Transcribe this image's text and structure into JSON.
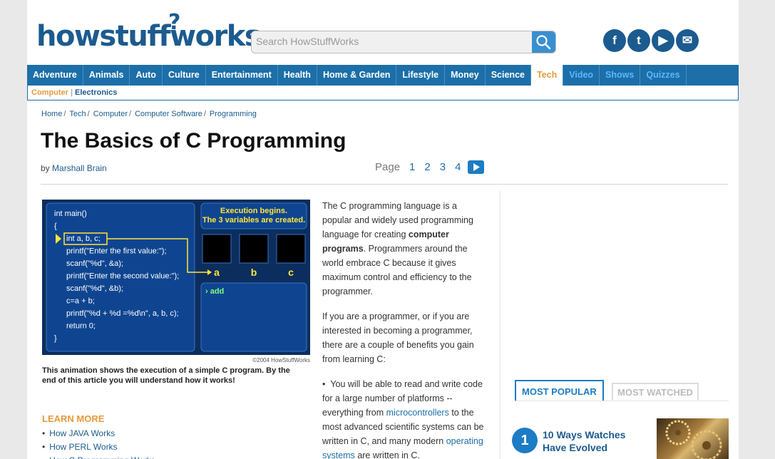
{
  "brand": {
    "logo_text": "howstuffworks",
    "logo_mark": "?"
  },
  "search": {
    "placeholder": "Search HowStuffWorks"
  },
  "social": [
    {
      "name": "facebook-icon",
      "glyph": "f"
    },
    {
      "name": "twitter-icon",
      "glyph": "t"
    },
    {
      "name": "youtube-icon",
      "glyph": "▶"
    },
    {
      "name": "email-icon",
      "glyph": "✉"
    }
  ],
  "nav": {
    "items": [
      "Adventure",
      "Animals",
      "Auto",
      "Culture",
      "Entertainment",
      "Health",
      "Home & Garden",
      "Lifestyle",
      "Money",
      "Science",
      "Tech",
      "Video",
      "Shows",
      "Quizzes"
    ],
    "active": "Tech"
  },
  "subnav": {
    "active": "Computer",
    "other": "Electronics"
  },
  "breadcrumb": [
    "Home",
    "Tech",
    "Computer",
    "Computer Software",
    "Programming"
  ],
  "article": {
    "title": "The Basics of C Programming",
    "author_prefix": "by",
    "author": "Marshall Brain",
    "pager_label": "Page",
    "pages": [
      "1",
      "2",
      "3",
      "4"
    ],
    "p1_a": "The C programming language is a popular and widely used programming language for creating ",
    "p1_bold": "computer programs",
    "p1_b": ". Programmers around the world embrace C because it gives maximum control and efficiency to the programmer.",
    "p2": "If you are a programmer, or if you are interested in becoming a programmer, there are a couple of benefits you gain from learning C:",
    "bullet_a": "You will be able to read and write code for a large number of platforms -- everything from ",
    "bullet_link1": "microcontrollers",
    "bullet_b": " to the most advanced scientific systems can be written in C, and many modern ",
    "bullet_link2": "operating systems",
    "bullet_c": " are written in C."
  },
  "figure": {
    "code_lines": [
      "int main()",
      "{",
      "int a, b, c;",
      "printf(\"Enter the first value:\");",
      "scanf(\"%d\", &a);",
      "printf(\"Enter the second value:\");",
      "scanf(\"%d\", &b);",
      "c=a + b;",
      "printf(\"%d + %d =%d\\n\", a, b, c);",
      "return 0;",
      "}"
    ],
    "banner_line1": "Execution begins.",
    "banner_line2": "The 3 variables are created.",
    "vars": [
      "a",
      "b",
      "c"
    ],
    "console": "› add",
    "credit": "©2004 HowStuffWorks",
    "caption": "This animation shows the execution of a simple C program. By the end of this article you will understand how it works!"
  },
  "learn_more": {
    "heading": "LEARN MORE",
    "links": [
      "How JAVA Works",
      "How PERL Works",
      "How C Programming Works"
    ]
  },
  "sidebar": {
    "tab_popular": "MOST POPULAR",
    "tab_watched": "MOST WATCHED",
    "top_item": {
      "rank": "1",
      "title": "10 Ways Watches Have Evolved"
    }
  }
}
